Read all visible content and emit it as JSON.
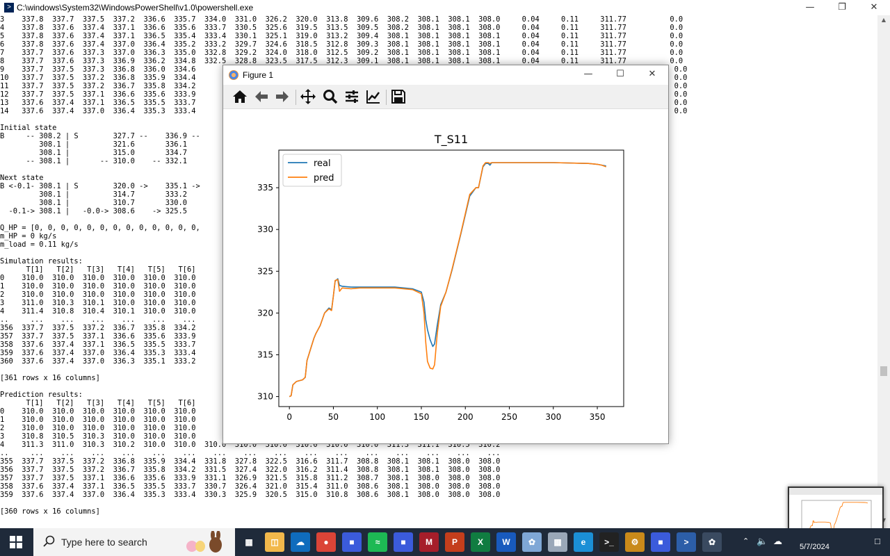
{
  "powershell": {
    "title": "C:\\windows\\System32\\WindowsPowerShell\\v1.0\\powershell.exe",
    "lines_top": [
      "3    337.8  337.7  337.5  337.2  336.6  335.7  334.0  331.0  326.2  320.0  313.8  309.6  308.2  308.1  308.1  308.0     0.04     0.11     311.77          0.0",
      "4    337.8  337.6  337.4  337.1  336.6  335.6  333.7  330.5  325.6  319.5  313.5  309.5  308.2  308.1  308.1  308.0     0.04     0.11     311.77          0.0",
      "5    337.8  337.6  337.4  337.1  336.5  335.4  333.4  330.1  325.1  319.0  313.2  309.4  308.1  308.1  308.1  308.1     0.04     0.11     311.77          0.0",
      "6    337.8  337.6  337.4  337.0  336.4  335.2  333.2  329.7  324.6  318.5  312.8  309.3  308.1  308.1  308.1  308.1     0.04     0.11     311.77          0.0",
      "7    337.7  337.6  337.3  337.0  336.3  335.0  332.8  329.2  324.0  318.0  312.5  309.2  308.1  308.1  308.1  308.1     0.04     0.11     311.77          0.0",
      "8    337.7  337.6  337.3  336.9  336.2  334.8  332.5  328.8  323.5  317.5  312.3  309.1  308.1  308.1  308.1  308.1     0.04     0.11     311.77          0.0",
      "9    337.7  337.5  337.3  336.8  336.0  334.6                                                                                                 .77          0.0",
      "10   337.7  337.5  337.2  336.8  335.9  334.4                                                                                                 .77          0.0",
      "11   337.7  337.5  337.2  336.7  335.8  334.2                                                                                                 .77          0.0",
      "12   337.7  337.5  337.1  336.6  335.6  333.9                                                                                                 .77          0.0",
      "13   337.6  337.4  337.1  336.5  335.5  333.7                                                                                                 .77          0.0",
      "14   337.6  337.4  337.0  336.4  335.3  333.4                                                                                                 .77          0.0",
      "",
      "Initial state",
      "B     -- 308.2 | S        327.7 --    336.9 --",
      "         308.1 |          321.6       336.1",
      "         308.1 |          315.0       334.7",
      "      -- 308.1 |       -- 310.0    -- 332.1",
      "",
      "Next state",
      "B <-0.1- 308.1 | S        320.0 ->    335.1 ->",
      "         308.1 |          314.7       333.2",
      "         308.1 |          310.7       330.0",
      "  -0.1-> 308.1 |   -0.0-> 308.6    -> 325.5",
      "",
      "Q_HP = [0, 0, 0, 0, 0, 0, 0, 0, 0, 0, 0, 0, 0,",
      "m_HP = 0 kg/s",
      "m_load = 0.11 kg/s",
      "",
      "Simulation results:",
      "      T[1]   T[2]   T[3]   T[4]   T[5]   T[6]",
      "0    310.0  310.0  310.0  310.0  310.0  310.0",
      "1    310.0  310.0  310.0  310.0  310.0  310.0",
      "2    310.0  310.0  310.0  310.0  310.0  310.0",
      "3    311.0  310.3  310.1  310.0  310.0  310.0",
      "4    311.4  310.8  310.4  310.1  310.0  310.0",
      "..     ...    ...    ...    ...    ...    ...",
      "356  337.7  337.5  337.2  336.7  335.8  334.2",
      "357  337.7  337.5  337.1  336.6  335.6  333.9",
      "358  337.6  337.4  337.1  336.5  335.5  333.7",
      "359  337.6  337.4  337.0  336.4  335.3  333.4",
      "360  337.6  337.4  337.0  336.3  335.1  333.2",
      "",
      "[361 rows x 16 columns]",
      "",
      "Prediction results:",
      "      T[1]   T[2]   T[3]   T[4]   T[5]   T[6]",
      "0    310.0  310.0  310.0  310.0  310.0  310.0",
      "1    310.0  310.0  310.0  310.0  310.0  310.0",
      "2    310.0  310.0  310.0  310.0  310.0  310.0",
      "3    310.8  310.5  310.3  310.0  310.0  310.0",
      "4    311.3  311.0  310.3  310.2  310.0  310.0  310.0  310.0  310.0  310.0  310.0  310.0  311.3  311.1  310.5  310.2",
      "..     ...    ...    ...    ...    ...    ...    ...    ...    ...    ...    ...    ...    ...    ...    ...    ...",
      "355  337.7  337.5  337.2  336.8  335.9  334.4  331.8  327.8  322.5  316.6  311.7  308.8  308.1  308.1  308.0  308.0",
      "356  337.7  337.5  337.2  336.7  335.8  334.2  331.5  327.4  322.0  316.2  311.4  308.8  308.1  308.1  308.0  308.0",
      "357  337.7  337.5  337.1  336.6  335.6  333.9  331.1  326.9  321.5  315.8  311.2  308.7  308.1  308.0  308.0  308.0",
      "358  337.6  337.4  337.1  336.5  335.5  333.7  330.7  326.4  321.0  315.4  311.0  308.6  308.1  308.0  308.0  308.0",
      "359  337.6  337.4  337.0  336.4  335.3  333.4  330.3  325.9  320.5  315.0  310.8  308.6  308.1  308.0  308.0  308.0",
      "",
      "[360 rows x 16 columns]"
    ]
  },
  "figure": {
    "title": "Figure 1",
    "toolbar": {
      "home": "home-icon",
      "back": "back-arrow-icon",
      "forward": "forward-arrow-icon",
      "pan": "pan-icon",
      "zoom": "zoom-icon",
      "subplots": "configure-subplots-icon",
      "axes": "edit-axes-icon",
      "save": "save-icon"
    }
  },
  "chart_data": {
    "type": "line",
    "title": "T_S11",
    "xlabel": "",
    "ylabel": "",
    "xlim": [
      -12,
      380
    ],
    "ylim": [
      308.8,
      339.5
    ],
    "xticks": [
      0,
      50,
      100,
      150,
      200,
      250,
      300,
      350
    ],
    "yticks": [
      310,
      315,
      320,
      325,
      330,
      335
    ],
    "legend_position": "top-left",
    "series": [
      {
        "name": "real",
        "color": "#1f77b4",
        "x": [
          0,
          2,
          4,
          8,
          15,
          18,
          20,
          25,
          28,
          30,
          35,
          40,
          45,
          48,
          50,
          52,
          55,
          57,
          60,
          70,
          80,
          100,
          120,
          140,
          150,
          153,
          155,
          157,
          160,
          163,
          165,
          168,
          172,
          178,
          185,
          195,
          205,
          212,
          215,
          220,
          223,
          226,
          228,
          230,
          250,
          300,
          340,
          350,
          355,
          360
        ],
        "y": [
          310.0,
          310.1,
          311.4,
          311.8,
          312.0,
          312.3,
          314.3,
          316.0,
          317.0,
          317.5,
          318.5,
          320.0,
          320.6,
          320.4,
          322.0,
          323.8,
          324.1,
          323.3,
          323.2,
          323.1,
          323.1,
          323.1,
          323.1,
          322.9,
          322.5,
          321.3,
          319.2,
          318.0,
          316.8,
          316.0,
          316.3,
          318.5,
          321.0,
          322.5,
          325.2,
          329.5,
          334.0,
          335.0,
          335.0,
          337.5,
          337.9,
          337.9,
          337.7,
          338.0,
          338.0,
          338.0,
          337.9,
          337.8,
          337.7,
          337.6
        ]
      },
      {
        "name": "pred",
        "color": "#ff7f0e",
        "x": [
          0,
          2,
          4,
          8,
          15,
          18,
          20,
          25,
          28,
          30,
          35,
          40,
          45,
          48,
          50,
          52,
          55,
          57,
          60,
          70,
          80,
          100,
          120,
          140,
          150,
          153,
          155,
          157,
          160,
          163,
          165,
          168,
          172,
          178,
          185,
          195,
          205,
          212,
          215,
          220,
          223,
          226,
          228,
          230,
          250,
          300,
          340,
          350,
          355,
          360
        ],
        "y": [
          310.0,
          310.1,
          311.4,
          311.8,
          312.0,
          312.3,
          314.3,
          316.0,
          317.0,
          317.5,
          318.5,
          320.0,
          320.5,
          320.3,
          322.0,
          323.9,
          324.0,
          322.6,
          323.0,
          322.9,
          323.0,
          323.0,
          323.0,
          322.8,
          322.3,
          320.0,
          316.5,
          314.2,
          313.4,
          313.3,
          313.8,
          317.5,
          320.8,
          322.5,
          325.3,
          329.6,
          334.2,
          335.0,
          335.0,
          337.6,
          338.0,
          338.0,
          337.9,
          338.0,
          338.0,
          338.0,
          337.9,
          337.8,
          337.7,
          337.5
        ]
      }
    ]
  },
  "taskbar": {
    "search_placeholder": "Type here to search",
    "apps": [
      "task-view-icon",
      "file-explorer-icon",
      "onedrive-icon",
      "chrome-icon",
      "app-icon",
      "spotify-icon",
      "app-icon",
      "mendeley-icon",
      "powerpoint-icon",
      "excel-icon",
      "word-icon",
      "paint-icon",
      "photos-icon",
      "edge-icon",
      "terminal-icon",
      "settings-icon",
      "app-icon",
      "powershell-icon",
      "matplotlib-icon"
    ],
    "clock_date": "5/7/2024"
  }
}
